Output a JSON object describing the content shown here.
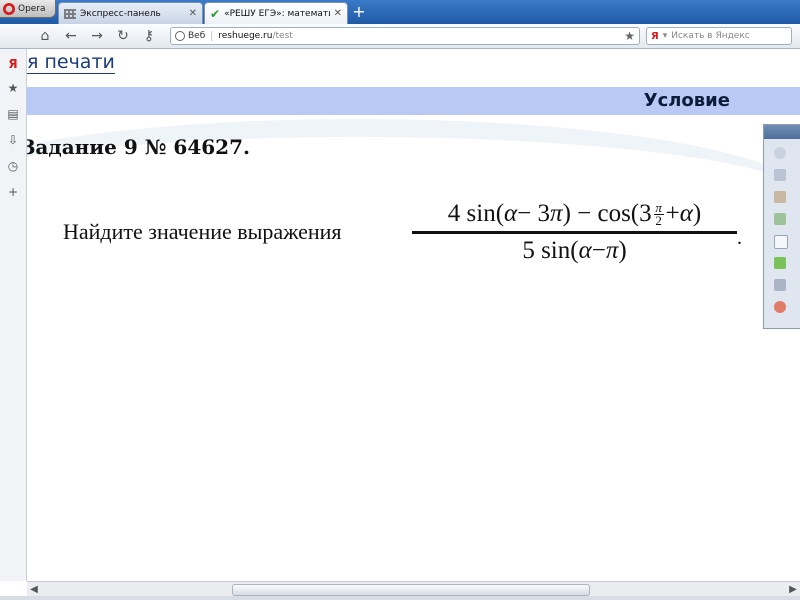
{
  "browser": {
    "menu_label": "Opera",
    "tabs": [
      {
        "label": "Экспресс-панель",
        "icon": "grid-icon"
      },
      {
        "label": "«РЕШУ ЕГЭ»: математи...",
        "icon": "check-icon"
      }
    ],
    "address": {
      "veb_label": "Веб",
      "url_host": "reshuege.ru",
      "url_path": "/test"
    },
    "search": {
      "placeholder": "Искать в Яндекс",
      "engine_letter": "Я"
    }
  },
  "page": {
    "print_link": "я печати",
    "condition_header": "Условие",
    "task_title": "Задание 9 № 64627.",
    "prompt": "Найдите значение выражения",
    "expression": {
      "numerator_left": "4 sin(",
      "alpha": "α",
      "numerator_mid": " − 3",
      "pi": "π",
      "numerator_right": ") − cos(3",
      "small_frac_num": "π",
      "small_frac_den": "2",
      "numerator_end_plus": " + ",
      "numerator_close": ")",
      "denominator_left": "5 sin(",
      "denominator_mid": " − ",
      "denominator_close": ")",
      "trailing": "."
    }
  },
  "colors": {
    "condition_bar": "#b9c9f5",
    "tab_bar": "#2f6bb8",
    "link": "#1c3c7a"
  }
}
